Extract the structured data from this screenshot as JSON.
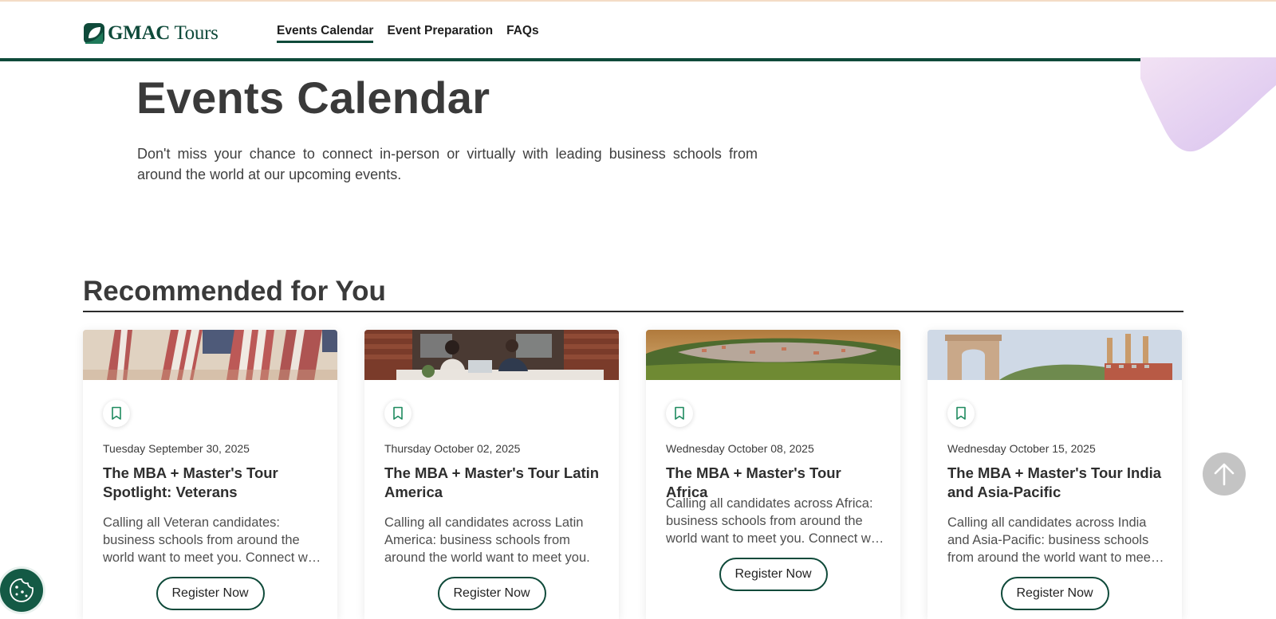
{
  "header": {
    "logo_bold": "GMAC",
    "logo_light": "Tours",
    "nav": [
      {
        "label": "Events Calendar",
        "active": true
      },
      {
        "label": "Event Preparation",
        "active": false
      },
      {
        "label": "FAQs",
        "active": false
      }
    ],
    "accent_color": "#0f4a3a"
  },
  "hero": {
    "title": "Events Calendar",
    "intro": "Don't miss your chance to connect in-person or virtually with leading business schools from around the world at our upcoming events."
  },
  "recommended": {
    "title": "Recommended for You",
    "cards": [
      {
        "image": "american-flags-photo",
        "date": "Tuesday September 30, 2025",
        "title": "The MBA + Master's Tour Spotlight: Veterans",
        "description": "Calling all Veteran candidates: business schools from around the world want to meet you. Connect with admissions representatives.",
        "button": "Register Now"
      },
      {
        "image": "office-meeting-photo",
        "date": "Thursday October 02, 2025",
        "title": "The MBA + Master's Tour Latin America",
        "description": "Calling all candidates across Latin America: business schools from around the world want to meet you.",
        "button": "Register Now"
      },
      {
        "image": "city-landscape-photo",
        "date": "Wednesday October 08, 2025",
        "title": "The MBA + Master's Tour Africa",
        "description": "Calling all candidates across Africa: business schools from around the world want to meet you. Connect with admissions representatives.",
        "button": "Register Now"
      },
      {
        "image": "india-gate-photo",
        "date": "Wednesday October 15, 2025",
        "title": "The MBA + Master's Tour India and Asia-Pacific",
        "description": "Calling all candidates across India and Asia-Pacific: business schools from around the world want to meet you.",
        "button": "Register Now"
      }
    ]
  },
  "icons": {
    "bookmark": "bookmark-icon",
    "scroll_top": "arrow-up-icon",
    "cookie": "cookie-icon"
  }
}
